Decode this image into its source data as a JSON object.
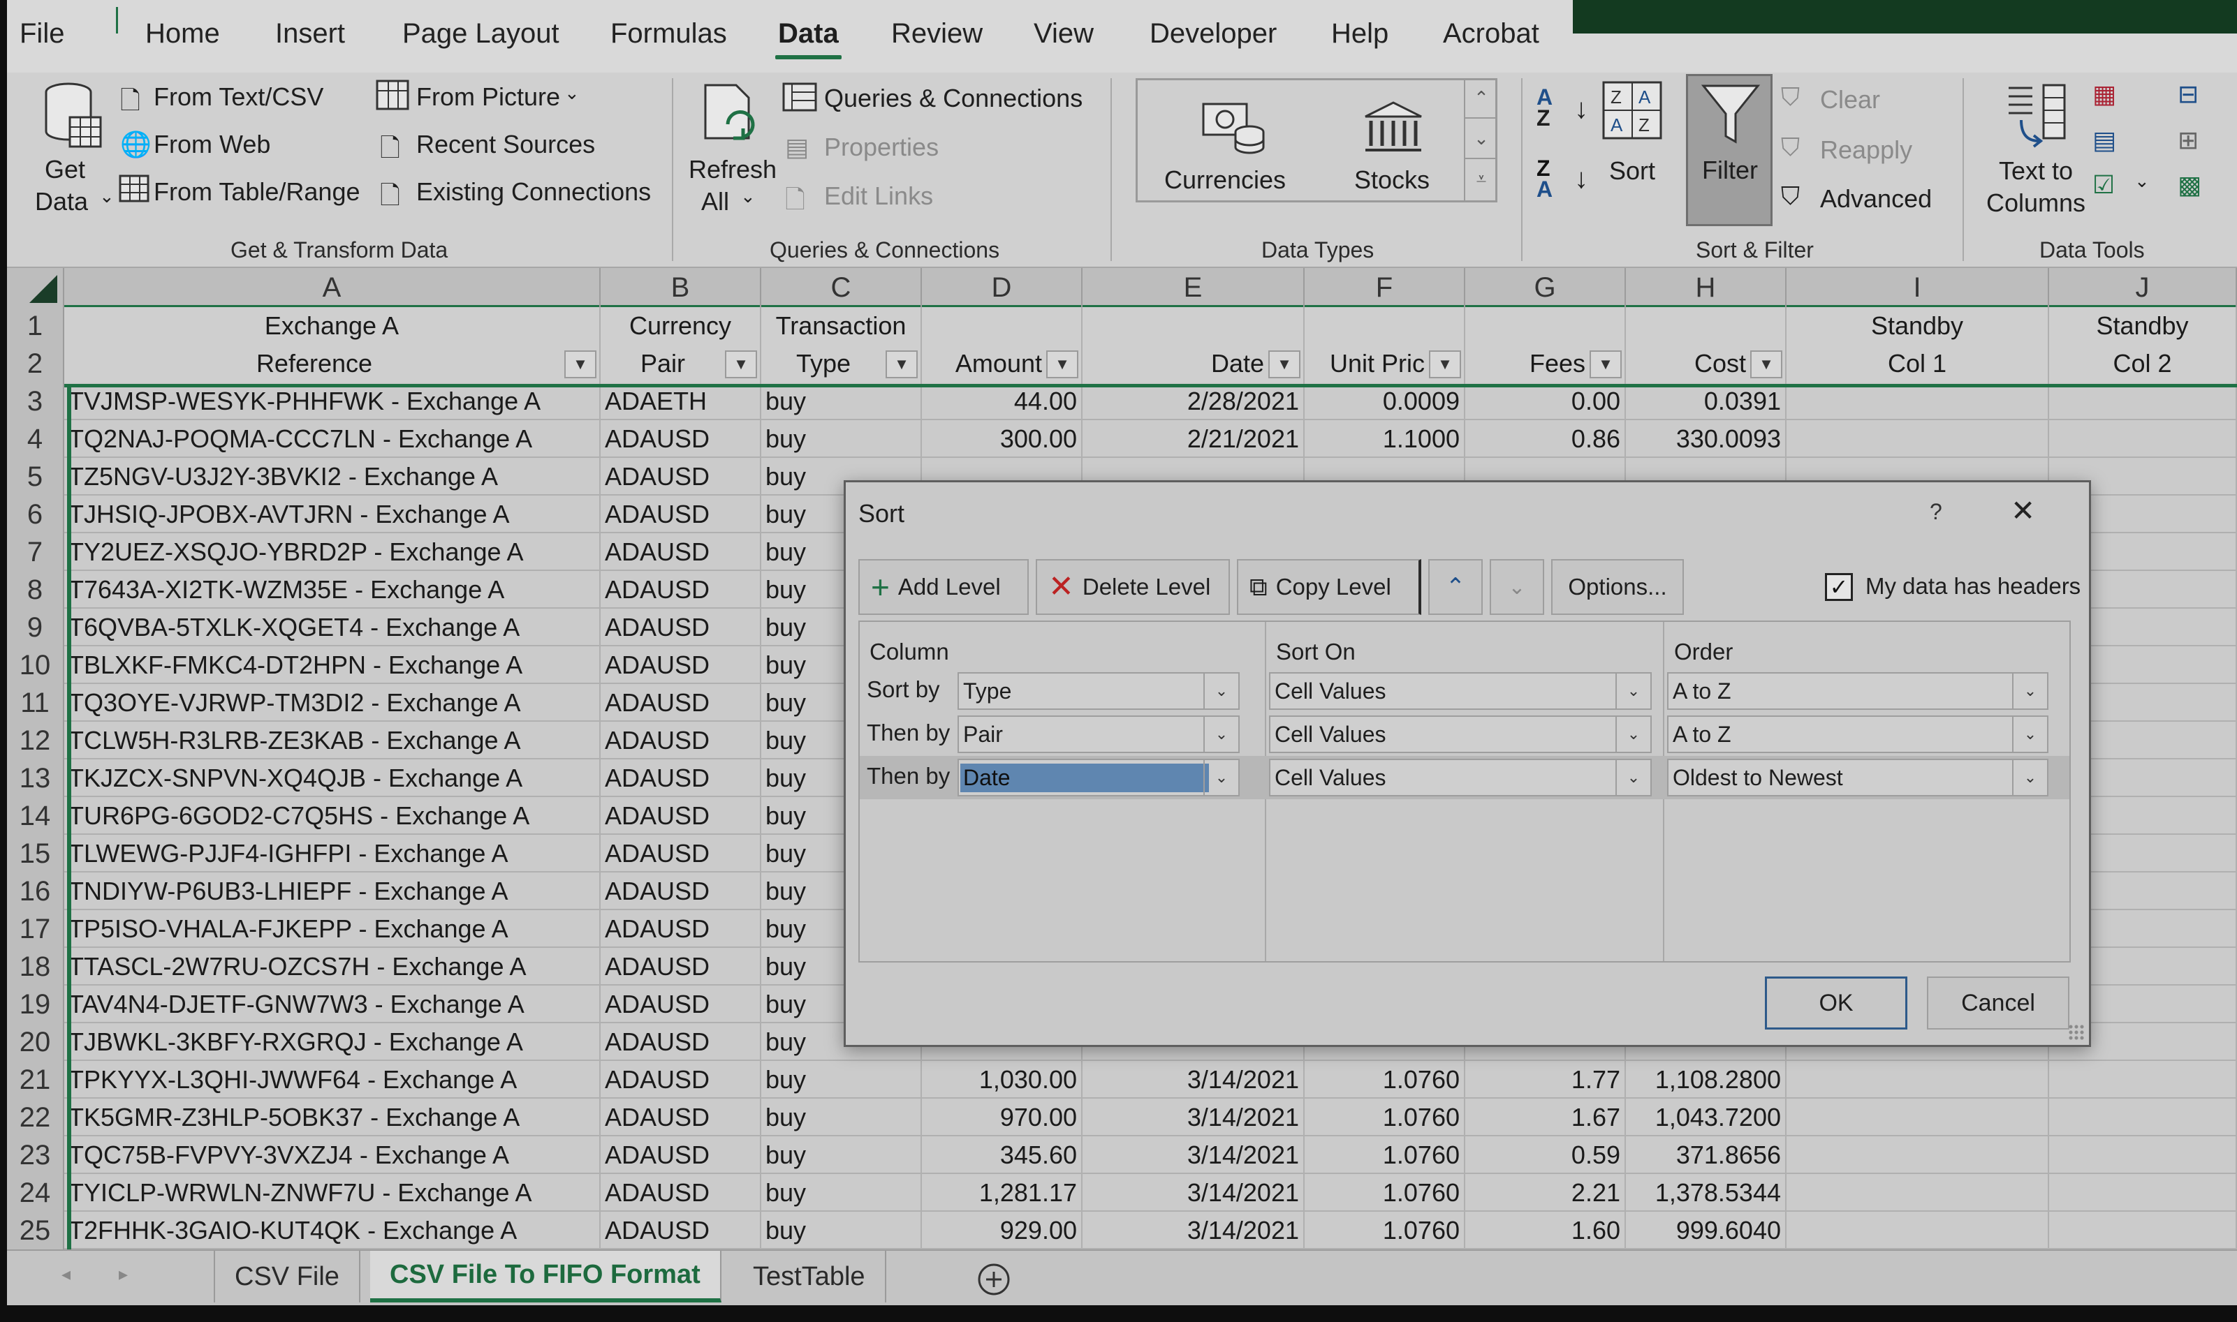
{
  "menu": [
    "File",
    "Home",
    "Insert",
    "Page Layout",
    "Formulas",
    "Data",
    "Review",
    "View",
    "Developer",
    "Help",
    "Acrobat"
  ],
  "menu_active": "Data",
  "ribbon": {
    "get_transform": {
      "get_data": "Get",
      "get_data2": "Data",
      "from_text_csv": "From Text/CSV",
      "from_web": "From Web",
      "from_table_range": "From Table/Range",
      "from_picture": "From Picture",
      "recent_sources": "Recent Sources",
      "existing_connections": "Existing Connections",
      "label": "Get & Transform Data"
    },
    "queries": {
      "refresh_all": "Refresh",
      "refresh_all2": "All",
      "queries_connections": "Queries & Connections",
      "properties": "Properties",
      "edit_links": "Edit Links",
      "label": "Queries & Connections"
    },
    "data_types": {
      "currencies": "Currencies",
      "stocks": "Stocks",
      "label": "Data Types"
    },
    "sort_filter": {
      "sort": "Sort",
      "filter": "Filter",
      "clear": "Clear",
      "reapply": "Reapply",
      "advanced": "Advanced",
      "label": "Sort & Filter"
    },
    "data_tools": {
      "text_to_columns": "Text to",
      "text_to_columns2": "Columns",
      "label": "Data Tools"
    }
  },
  "grid": {
    "columns": [
      "A",
      "B",
      "C",
      "D",
      "E",
      "F",
      "G",
      "H",
      "I",
      "J"
    ],
    "header_row1": [
      "Exchange A",
      "Currency",
      "Transaction",
      "",
      "",
      "",
      "",
      "",
      "Standby",
      "Standby"
    ],
    "header_row2": [
      "Reference",
      "Pair",
      "Type",
      "Amount",
      "Date",
      "Unit Pric",
      "Fees",
      "Cost",
      "Col 1",
      "Col 2"
    ],
    "rows": [
      {
        "n": "3",
        "ref": "TVJMSP-WESYK-PHHFWK - Exchange A",
        "pair": "ADAETH",
        "type": "buy",
        "amount": "44.00",
        "date": "2/28/2021",
        "unit": "0.0009",
        "fees": "0.00",
        "cost": "0.0391"
      },
      {
        "n": "4",
        "ref": "TQ2NAJ-POQMA-CCC7LN - Exchange A",
        "pair": "ADAUSD",
        "type": "buy",
        "amount": "300.00",
        "date": "2/21/2021",
        "unit": "1.1000",
        "fees": "0.86",
        "cost": "330.0093"
      },
      {
        "n": "5",
        "ref": "TZ5NGV-U3J2Y-3BVKI2 - Exchange A",
        "pair": "ADAUSD",
        "type": "buy",
        "amount": "",
        "date": "",
        "unit": "",
        "fees": "",
        "cost": ""
      },
      {
        "n": "6",
        "ref": "TJHSIQ-JPOBX-AVTJRN - Exchange A",
        "pair": "ADAUSD",
        "type": "buy",
        "amount": "",
        "date": "",
        "unit": "",
        "fees": "",
        "cost": ""
      },
      {
        "n": "7",
        "ref": "TY2UEZ-XSQJO-YBRD2P - Exchange A",
        "pair": "ADAUSD",
        "type": "buy",
        "amount": "",
        "date": "",
        "unit": "",
        "fees": "",
        "cost": ""
      },
      {
        "n": "8",
        "ref": "T7643A-XI2TK-WZM35E - Exchange A",
        "pair": "ADAUSD",
        "type": "buy",
        "amount": "",
        "date": "",
        "unit": "",
        "fees": "",
        "cost": ""
      },
      {
        "n": "9",
        "ref": "T6QVBA-5TXLK-XQGET4 - Exchange A",
        "pair": "ADAUSD",
        "type": "buy",
        "amount": "",
        "date": "",
        "unit": "",
        "fees": "",
        "cost": ""
      },
      {
        "n": "10",
        "ref": "TBLXKF-FMKC4-DT2HPN - Exchange A",
        "pair": "ADAUSD",
        "type": "buy",
        "amount": "",
        "date": "",
        "unit": "",
        "fees": "",
        "cost": ""
      },
      {
        "n": "11",
        "ref": "TQ3OYE-VJRWP-TM3DI2 - Exchange A",
        "pair": "ADAUSD",
        "type": "buy",
        "amount": "",
        "date": "",
        "unit": "",
        "fees": "",
        "cost": ""
      },
      {
        "n": "12",
        "ref": "TCLW5H-R3LRB-ZE3KAB - Exchange A",
        "pair": "ADAUSD",
        "type": "buy",
        "amount": "",
        "date": "",
        "unit": "",
        "fees": "",
        "cost": ""
      },
      {
        "n": "13",
        "ref": "TKJZCX-SNPVN-XQ4QJB - Exchange A",
        "pair": "ADAUSD",
        "type": "buy",
        "amount": "",
        "date": "",
        "unit": "",
        "fees": "",
        "cost": ""
      },
      {
        "n": "14",
        "ref": "TUR6PG-6GOD2-C7Q5HS - Exchange A",
        "pair": "ADAUSD",
        "type": "buy",
        "amount": "",
        "date": "",
        "unit": "",
        "fees": "",
        "cost": ""
      },
      {
        "n": "15",
        "ref": "TLWEWG-PJJF4-IGHFPI - Exchange A",
        "pair": "ADAUSD",
        "type": "buy",
        "amount": "",
        "date": "",
        "unit": "",
        "fees": "",
        "cost": ""
      },
      {
        "n": "16",
        "ref": "TNDIYW-P6UB3-LHIEPF - Exchange A",
        "pair": "ADAUSD",
        "type": "buy",
        "amount": "",
        "date": "",
        "unit": "",
        "fees": "",
        "cost": ""
      },
      {
        "n": "17",
        "ref": "TP5ISO-VHALA-FJKEPP - Exchange A",
        "pair": "ADAUSD",
        "type": "buy",
        "amount": "",
        "date": "",
        "unit": "",
        "fees": "",
        "cost": ""
      },
      {
        "n": "18",
        "ref": "TTASCL-2W7RU-OZCS7H - Exchange A",
        "pair": "ADAUSD",
        "type": "buy",
        "amount": "",
        "date": "",
        "unit": "",
        "fees": "",
        "cost": ""
      },
      {
        "n": "19",
        "ref": "TAV4N4-DJETF-GNW7W3 - Exchange A",
        "pair": "ADAUSD",
        "type": "buy",
        "amount": "",
        "date": "",
        "unit": "",
        "fees": "",
        "cost": ""
      },
      {
        "n": "20",
        "ref": "TJBWKL-3KBFY-RXGRQJ - Exchange A",
        "pair": "ADAUSD",
        "type": "buy",
        "amount": "",
        "date": "",
        "unit": "",
        "fees": "",
        "cost": ""
      },
      {
        "n": "21",
        "ref": "TPKYYX-L3QHI-JWWF64 - Exchange A",
        "pair": "ADAUSD",
        "type": "buy",
        "amount": "1,030.00",
        "date": "3/14/2021",
        "unit": "1.0760",
        "fees": "1.77",
        "cost": "1,108.2800"
      },
      {
        "n": "22",
        "ref": "TK5GMR-Z3HLP-5OBK37 - Exchange A",
        "pair": "ADAUSD",
        "type": "buy",
        "amount": "970.00",
        "date": "3/14/2021",
        "unit": "1.0760",
        "fees": "1.67",
        "cost": "1,043.7200"
      },
      {
        "n": "23",
        "ref": "TQC75B-FVPVY-3VXZJ4 - Exchange A",
        "pair": "ADAUSD",
        "type": "buy",
        "amount": "345.60",
        "date": "3/14/2021",
        "unit": "1.0760",
        "fees": "0.59",
        "cost": "371.8656"
      },
      {
        "n": "24",
        "ref": "TYICLP-WRWLN-ZNWF7U - Exchange A",
        "pair": "ADAUSD",
        "type": "buy",
        "amount": "1,281.17",
        "date": "3/14/2021",
        "unit": "1.0760",
        "fees": "2.21",
        "cost": "1,378.5344"
      },
      {
        "n": "25",
        "ref": "T2FHHK-3GAIO-KUT4QK - Exchange A",
        "pair": "ADAUSD",
        "type": "buy",
        "amount": "929.00",
        "date": "3/14/2021",
        "unit": "1.0760",
        "fees": "1.60",
        "cost": "999.6040"
      }
    ]
  },
  "sheets": [
    "CSV File",
    "CSV File To FIFO Format",
    "TestTable"
  ],
  "active_sheet": "CSV File To FIFO Format",
  "dialog": {
    "title": "Sort",
    "help": "?",
    "close": "✕",
    "add_level": "Add Level",
    "delete_level": "Delete Level",
    "copy_level": "Copy Level",
    "options": "Options...",
    "headers_checkbox": "My data has headers",
    "headers_checked": true,
    "col_header": "Column",
    "sort_on_header": "Sort On",
    "order_header": "Order",
    "levels": [
      {
        "label": "Sort by",
        "column": "Type",
        "sort_on": "Cell Values",
        "order": "A to Z"
      },
      {
        "label": "Then by",
        "column": "Pair",
        "sort_on": "Cell Values",
        "order": "A to Z"
      },
      {
        "label": "Then by",
        "column": "Date",
        "sort_on": "Cell Values",
        "order": "Oldest to Newest"
      }
    ],
    "ok": "OK",
    "cancel": "Cancel"
  },
  "colors": {
    "excel_green": "#1f7145",
    "selection_blue": "#5f86b0",
    "ok_border": "#2e5a8a"
  }
}
